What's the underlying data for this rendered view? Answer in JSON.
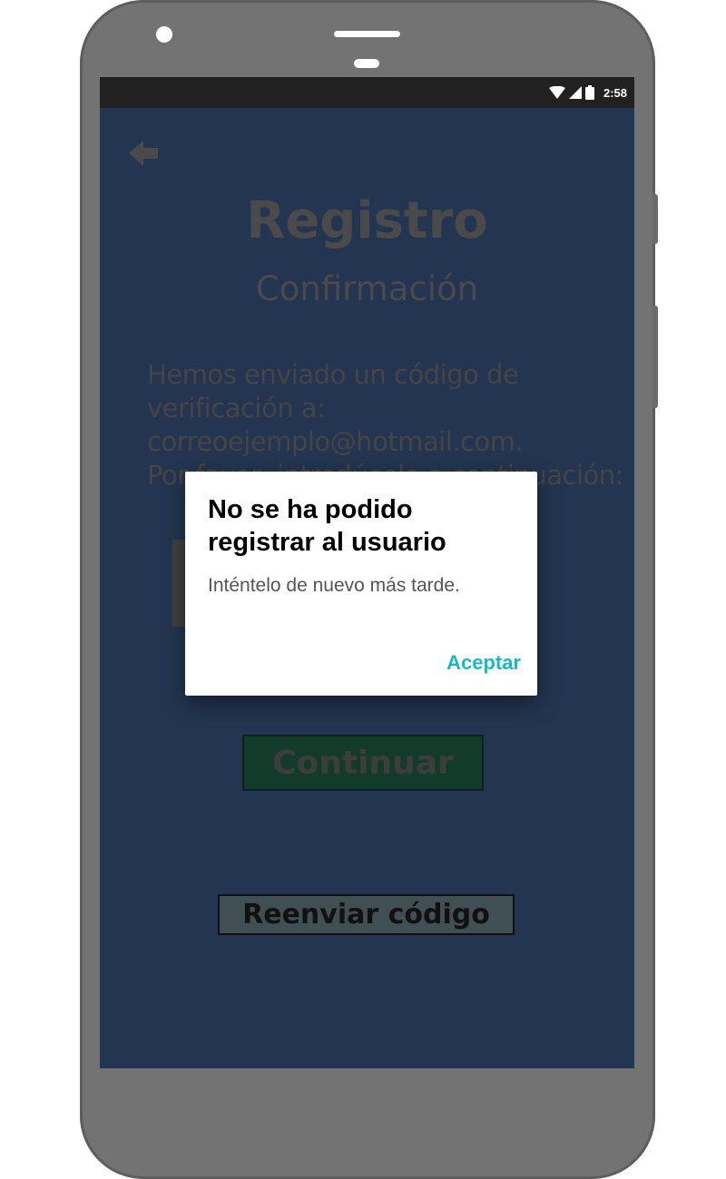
{
  "status_bar": {
    "time": "2:58"
  },
  "page": {
    "title": "Registro",
    "subtitle": "Confirmación",
    "info_line1": "Hemos enviado un código de",
    "info_line2": "verificación a:",
    "info_line3": "correoejemplo@hotmail.com.",
    "info_line4": "Por favor, introdúcelo a continuación:",
    "continue_label": "Continuar",
    "resend_label": "Reenviar código"
  },
  "dialog": {
    "title": "No se ha podido registrar al usuario",
    "message": "Inténtelo de nuevo más tarde.",
    "accept_label": "Aceptar"
  },
  "icons": {
    "back": "arrow-left-icon",
    "wifi": "wifi-icon",
    "signal": "cell-signal-icon",
    "battery": "battery-icon"
  },
  "colors": {
    "screen_background": "#233550",
    "dialog_accent": "#19b8c9",
    "continue_button": "#133b2c",
    "resend_button": "#404f52"
  }
}
